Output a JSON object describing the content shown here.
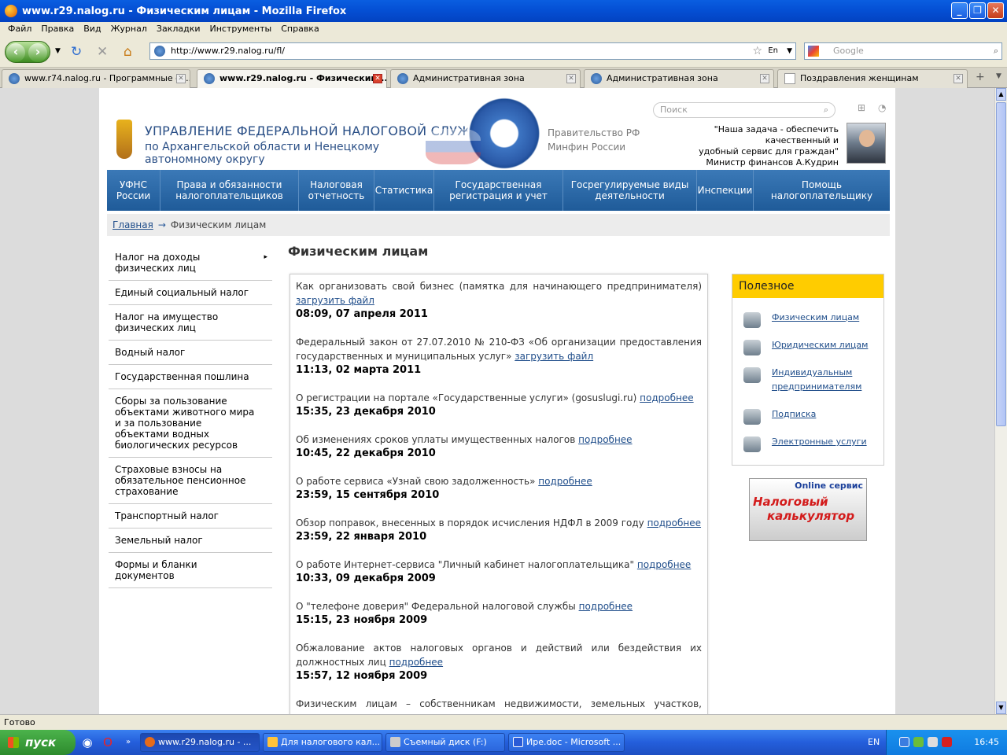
{
  "window": {
    "title": "www.r29.nalog.ru - Физическим лицам - Mozilla Firefox"
  },
  "menu": [
    "Файл",
    "Правка",
    "Вид",
    "Журнал",
    "Закладки",
    "Инструменты",
    "Справка"
  ],
  "address": {
    "url": "http://www.r29.nalog.ru/fl/",
    "search_placeholder": "Google",
    "lang_badge": "En"
  },
  "tabs": [
    {
      "label": "www.r74.nalog.ru - Программные ср..."
    },
    {
      "label": "www.r29.nalog.ru - Физическим ...",
      "active": true
    },
    {
      "label": "Административная зона"
    },
    {
      "label": "Административная зона"
    },
    {
      "label": "Поздравления женщинам"
    }
  ],
  "header": {
    "org_line1": "УПРАВЛЕНИЕ ФЕДЕРАЛЬНОЙ НАЛОГОВОЙ СЛУЖБЫ",
    "org_line2": "по Архангельской области и Ненецкому",
    "org_line3": "автономному округу",
    "link_gov": "Правительство РФ",
    "link_minfin": "Минфин России",
    "search_placeholder": "Поиск",
    "quote_line1": "\"Наша задача - обеспечить качественный и",
    "quote_line2": "удобный сервис для граждан\"",
    "quote_author": "Министр финансов А.Кудрин"
  },
  "mainnav": [
    {
      "l1": "УФНС",
      "l2": "России"
    },
    {
      "l1": "Права и обязанности",
      "l2": "налогоплательщиков"
    },
    {
      "l1": "Налоговая",
      "l2": "отчетность"
    },
    {
      "l1": "Статистика",
      "l2": ""
    },
    {
      "l1": "Государственная",
      "l2": "регистрация и учет"
    },
    {
      "l1": "Госрегулируемые виды",
      "l2": "деятельности"
    },
    {
      "l1": "Инспекции",
      "l2": ""
    },
    {
      "l1": "Помощь",
      "l2": "налогоплательщику"
    }
  ],
  "breadcrumb": {
    "home": "Главная",
    "arrow": "→",
    "current": "Физическим лицам"
  },
  "sidebar": [
    "Налог на доходы физических лиц",
    "Единый социальный налог",
    "Налог на имущество физических лиц",
    "Водный налог",
    "Государственная пошлина",
    "Сборы за пользование объектами животного мира и за пользование объектами водных биологических ресурсов",
    "Страховые взносы на обязательное пенсионное страхование",
    "Транспортный налог",
    "Земельный налог",
    "Формы и бланки документов"
  ],
  "page_title": "Физическим лицам",
  "news": [
    {
      "text": "Как организовать свой бизнес (памятка для начинающего предпринимателя)",
      "link": "загрузить файл",
      "date": "08:09, 07 апреля 2011"
    },
    {
      "text": "Федеральный закон от 27.07.2010 № 210-ФЗ «Об организации предоставления государственных и муниципальных услуг»",
      "link": "загрузить файл",
      "date": "11:13, 02 марта 2011"
    },
    {
      "text": "О регистрации на портале «Государственные услуги» (gosuslugi.ru)",
      "link": "подробнее",
      "date": "15:35, 23 декабря 2010"
    },
    {
      "text": "Об изменениях сроков уплаты имущественных налогов",
      "link": "подробнее",
      "date": "10:45, 22 декабря 2010"
    },
    {
      "text": "О работе сервиса «Узнай свою задолженность»",
      "link": "подробнее",
      "date": "23:59, 15 сентября 2010"
    },
    {
      "text": "Обзор поправок, внесенных в порядок исчисления НДФЛ в 2009 году",
      "link": "подробнее",
      "date": "23:59, 22 января 2010"
    },
    {
      "text": "О работе Интернет-сервиса \"Личный кабинет налогоплательщика\"",
      "link": "подробнее",
      "date": "10:33, 09 декабря 2009"
    },
    {
      "text": "О \"телефоне доверия\" Федеральной налоговой службы",
      "link": "подробнее",
      "date": "15:15, 23 ноября 2009"
    },
    {
      "text": "Обжалование актов налоговых органов и действий или бездействия их должностных лиц",
      "link": "подробнее",
      "date": "15:57, 12 ноября 2009"
    },
    {
      "text": "Физическим лицам – собственникам недвижимости, земельных участков, транспорта",
      "link": "",
      "date": ""
    }
  ],
  "useful": {
    "title": "Полезное",
    "items": [
      "Физическим лицам",
      "Юридическим лицам",
      "Индивидуальным",
      "предпринимателям",
      "Подписка",
      "Электронные услуги"
    ]
  },
  "banner": {
    "online": "Online сервис",
    "line1": "Налоговый",
    "line2": "калькулятор"
  },
  "status": "Готово",
  "taskbar": {
    "start": "пуск",
    "tasks": [
      "www.r29.nalog.ru - ...",
      "Для налогового кал...",
      "Съемный диск (F:)",
      "Ире.doc - Microsoft ..."
    ],
    "lang": "EN",
    "clock": "16:45"
  }
}
